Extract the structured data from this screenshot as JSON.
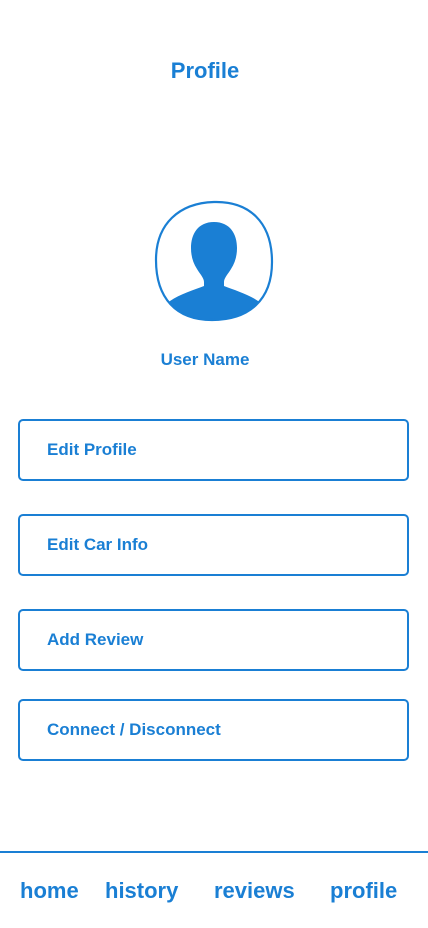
{
  "header": {
    "title": "Profile"
  },
  "profile": {
    "avatar_icon": "user-silhouette-icon",
    "user_name": "User Name"
  },
  "menu": {
    "items": [
      {
        "label": "Edit Profile"
      },
      {
        "label": "Edit Car Info"
      },
      {
        "label": "Add Review"
      },
      {
        "label": "Connect / Disconnect"
      }
    ]
  },
  "tab_bar": {
    "tabs": [
      {
        "label": "home"
      },
      {
        "label": "history"
      },
      {
        "label": "reviews"
      },
      {
        "label": "profile"
      }
    ]
  },
  "colors": {
    "accent": "#1a7fd4",
    "background": "#ffffff"
  }
}
